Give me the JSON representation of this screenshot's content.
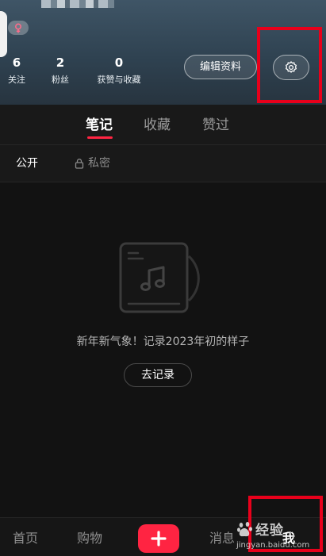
{
  "stats": [
    {
      "num": "6",
      "label": "关注"
    },
    {
      "num": "2",
      "label": "粉丝"
    },
    {
      "num": "0",
      "label": "获赞与收藏"
    }
  ],
  "header": {
    "edit_profile": "编辑资料",
    "settings_icon": "gear-icon",
    "gender_icon": "female-icon"
  },
  "tabs": [
    {
      "label": "笔记",
      "active": true
    },
    {
      "label": "收藏",
      "active": false
    },
    {
      "label": "赞过",
      "active": false
    }
  ],
  "subtabs": {
    "public": "公开",
    "private": "私密"
  },
  "empty": {
    "message": "新年新气象！记录2023年初的样子",
    "button": "去记录"
  },
  "nav": {
    "home": "首页",
    "shop": "购物",
    "messages": "消息",
    "me": "我"
  },
  "watermark": {
    "brand": "经验",
    "url": "jingyan.baidu.com"
  },
  "colors": {
    "accent": "#ff2442",
    "highlight_box": "#e8001b",
    "background": "#121212"
  }
}
